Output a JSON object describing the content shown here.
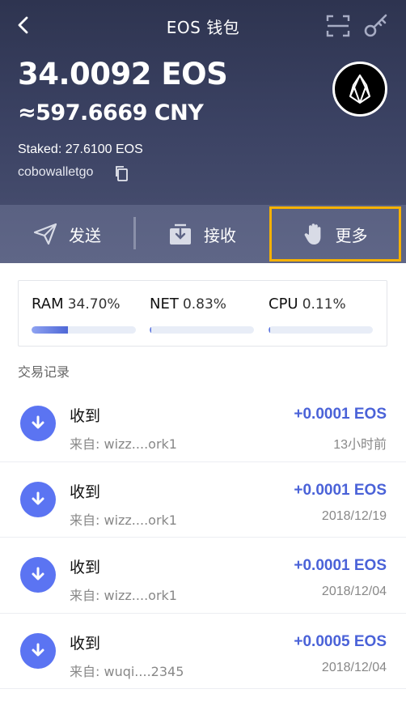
{
  "nav": {
    "title": "EOS 钱包"
  },
  "wallet": {
    "balance": "34.0092 EOS",
    "fiat": "≈597.6669 CNY",
    "staked": "Staked: 27.6100 EOS",
    "account": "cobowalletgo"
  },
  "actions": [
    {
      "label": "发送",
      "icon": "paper-plane-icon"
    },
    {
      "label": "接收",
      "icon": "inbox-download-icon"
    },
    {
      "label": "更多",
      "icon": "hand-icon"
    }
  ],
  "resources": [
    {
      "name": "RAM",
      "value": "34.70%",
      "fraction": 0.347
    },
    {
      "name": "NET",
      "value": "0.83%",
      "fraction": 0.0083
    },
    {
      "name": "CPU",
      "value": "0.11%",
      "fraction": 0.0011
    }
  ],
  "transactions_title": "交易记录",
  "transactions": [
    {
      "title": "收到",
      "from": "来自: wizz....ork1",
      "amount": "+0.0001 EOS",
      "time": "13小时前"
    },
    {
      "title": "收到",
      "from": "来自: wizz....ork1",
      "amount": "+0.0001 EOS",
      "time": "2018/12/19"
    },
    {
      "title": "收到",
      "from": "来自: wizz....ork1",
      "amount": "+0.0001 EOS",
      "time": "2018/12/04"
    },
    {
      "title": "收到",
      "from": "来自: wuqi....2345",
      "amount": "+0.0005 EOS",
      "time": "2018/12/04"
    }
  ],
  "colors": {
    "header_bg": "#3b4263",
    "action_bar_bg": "#5f6687",
    "highlight_border": "#f5b100",
    "accent_blue": "#4a62d8",
    "tx_icon_bg": "#5b74f2"
  }
}
